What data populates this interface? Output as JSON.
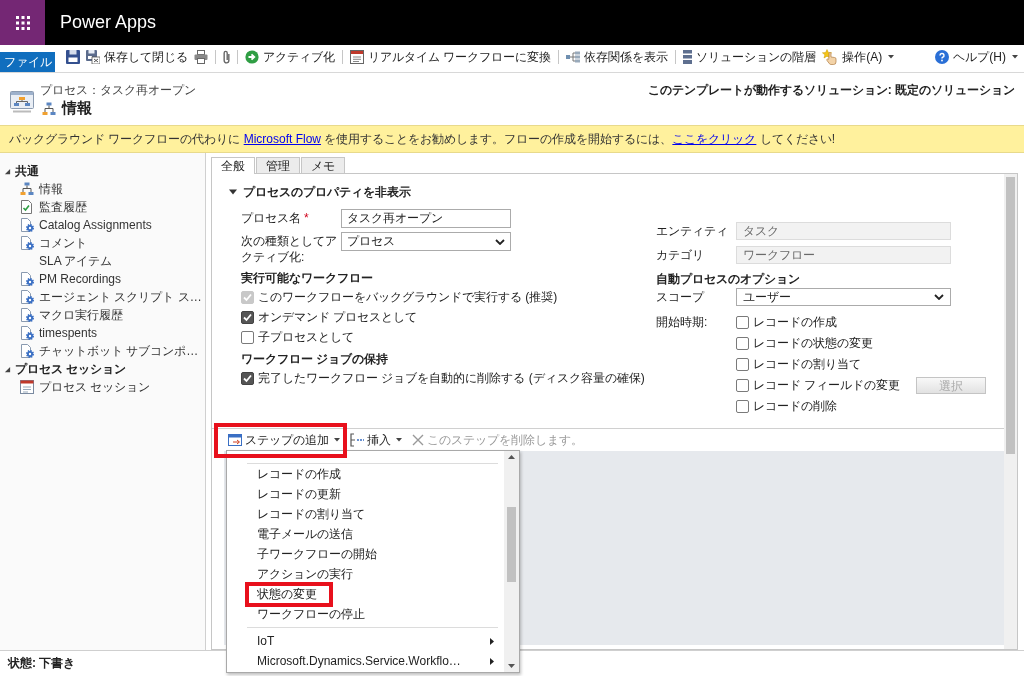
{
  "app_bar": {
    "title": "Power Apps"
  },
  "ribbon": {
    "file_tab": "ファイル",
    "buttons": [
      {
        "label": "保存して閉じる",
        "dropdown": false
      },
      {
        "label": "アクティブ化",
        "dropdown": false
      },
      {
        "label": "リアルタイム ワークフローに変換",
        "dropdown": false
      },
      {
        "label": "依存関係を表示",
        "dropdown": false
      },
      {
        "label": "ソリューションの階層",
        "dropdown": false
      },
      {
        "label": "操作(A)",
        "dropdown": true
      }
    ],
    "help": {
      "label": "ヘルプ(H)",
      "dropdown": true
    }
  },
  "header": {
    "breadcrumb": "プロセス：タスク再オープン",
    "title": "情報",
    "solution_note": "このテンプレートが動作するソリューション: 既定のソリューション"
  },
  "banner": {
    "parts": [
      {
        "text": "バックグラウンド ワークフローの代わりに ",
        "kind": "text"
      },
      {
        "text": "Microsoft Flow",
        "kind": "link"
      },
      {
        "text": " を使用することをお勧めします。フローの作成を開始するには、",
        "kind": "text"
      },
      {
        "text": "ここをクリック",
        "kind": "link"
      },
      {
        "text": " してください!",
        "kind": "text"
      }
    ]
  },
  "nav": {
    "sections": [
      {
        "label": "共通",
        "expanded": true,
        "children": [
          {
            "label": "情報",
            "kind": "info"
          },
          {
            "label": "監査履歴",
            "kind": "audit"
          },
          {
            "label": "Catalog Assignments",
            "kind": "entity"
          },
          {
            "label": "コメント",
            "kind": "entity"
          },
          {
            "label": "SLA アイテム",
            "kind": "plain"
          },
          {
            "label": "PM Recordings",
            "kind": "entity"
          },
          {
            "label": "エージェント スクリプト ス…",
            "kind": "entity"
          },
          {
            "label": "マクロ実行履歴",
            "kind": "entity"
          },
          {
            "label": "timespents",
            "kind": "entity"
          },
          {
            "label": "チャットボット サブコンポ…",
            "kind": "entity"
          }
        ]
      },
      {
        "label": "プロセス セッション",
        "expanded": true,
        "children": [
          {
            "label": "プロセス セッション",
            "kind": "session"
          }
        ]
      }
    ]
  },
  "tabs": [
    {
      "label": "全般",
      "selected": true
    },
    {
      "label": "管理",
      "selected": false
    },
    {
      "label": "メモ",
      "selected": false
    }
  ],
  "section": {
    "title": "プロセスのプロパティを非表示",
    "expanded": true
  },
  "process_name": {
    "label": "プロセス名",
    "required_mark": "*",
    "value": "タスク再オープン"
  },
  "activate_as": {
    "label": "次の種類としてアクティブ化:",
    "value": "プロセス"
  },
  "available_workflows": {
    "heading": "実行可能なワークフロー",
    "options": [
      {
        "label": "このワークフローをバックグラウンドで実行する (推奨)",
        "checked": true,
        "disabled": true
      },
      {
        "label": "オンデマンド プロセスとして",
        "checked": true,
        "disabled": false
      },
      {
        "label": "子プロセスとして",
        "checked": false,
        "disabled": false
      }
    ]
  },
  "job_retention": {
    "heading": "ワークフロー ジョブの保持",
    "options": [
      {
        "label": "完了したワークフロー ジョブを自動的に削除する (ディスク容量の確保)",
        "checked": true
      }
    ]
  },
  "entity": {
    "label": "エンティティ",
    "value": "タスク"
  },
  "category": {
    "label": "カテゴリ",
    "value": "ワークフロー"
  },
  "auto_options": {
    "heading": "自動プロセスのオプション",
    "scope": {
      "label": "スコープ",
      "value": "ユーザー"
    },
    "start_when": {
      "label": "開始時期:",
      "options": [
        {
          "label": "レコードの作成",
          "checked": false
        },
        {
          "label": "レコードの状態の変更",
          "checked": false
        },
        {
          "label": "レコードの割り当て",
          "checked": false
        },
        {
          "label": "レコード フィールドの変更",
          "checked": false,
          "button": {
            "label": "選択",
            "disabled": true
          }
        },
        {
          "label": "レコードの削除",
          "checked": false
        }
      ]
    }
  },
  "steps": {
    "add_step": {
      "label": "ステップの追加",
      "highlighted": true
    },
    "insert": {
      "label": "挿入"
    },
    "delete": {
      "label": "このステップを削除します。",
      "disabled": true
    }
  },
  "step_menu": {
    "items": [
      {
        "label": "レコードの作成",
        "kind": "action",
        "highlighted": false
      },
      {
        "label": "レコードの更新",
        "kind": "action",
        "highlighted": false
      },
      {
        "label": "レコードの割り当て",
        "kind": "action",
        "highlighted": false
      },
      {
        "label": "電子メールの送信",
        "kind": "action",
        "highlighted": false
      },
      {
        "label": "子ワークフローの開始",
        "kind": "action",
        "highlighted": false
      },
      {
        "label": "アクションの実行",
        "kind": "action",
        "highlighted": false
      },
      {
        "label": "状態の変更",
        "kind": "action",
        "highlighted": true
      },
      {
        "label": "ワークフローの停止",
        "kind": "action",
        "highlighted": false
      },
      {
        "label": "IoT",
        "kind": "submenu",
        "highlighted": false
      },
      {
        "label": "Microsoft.Dynamics.Service.Workflo…",
        "kind": "submenu",
        "highlighted": false
      }
    ]
  },
  "status_bar": {
    "text": "状態: 下書き"
  }
}
